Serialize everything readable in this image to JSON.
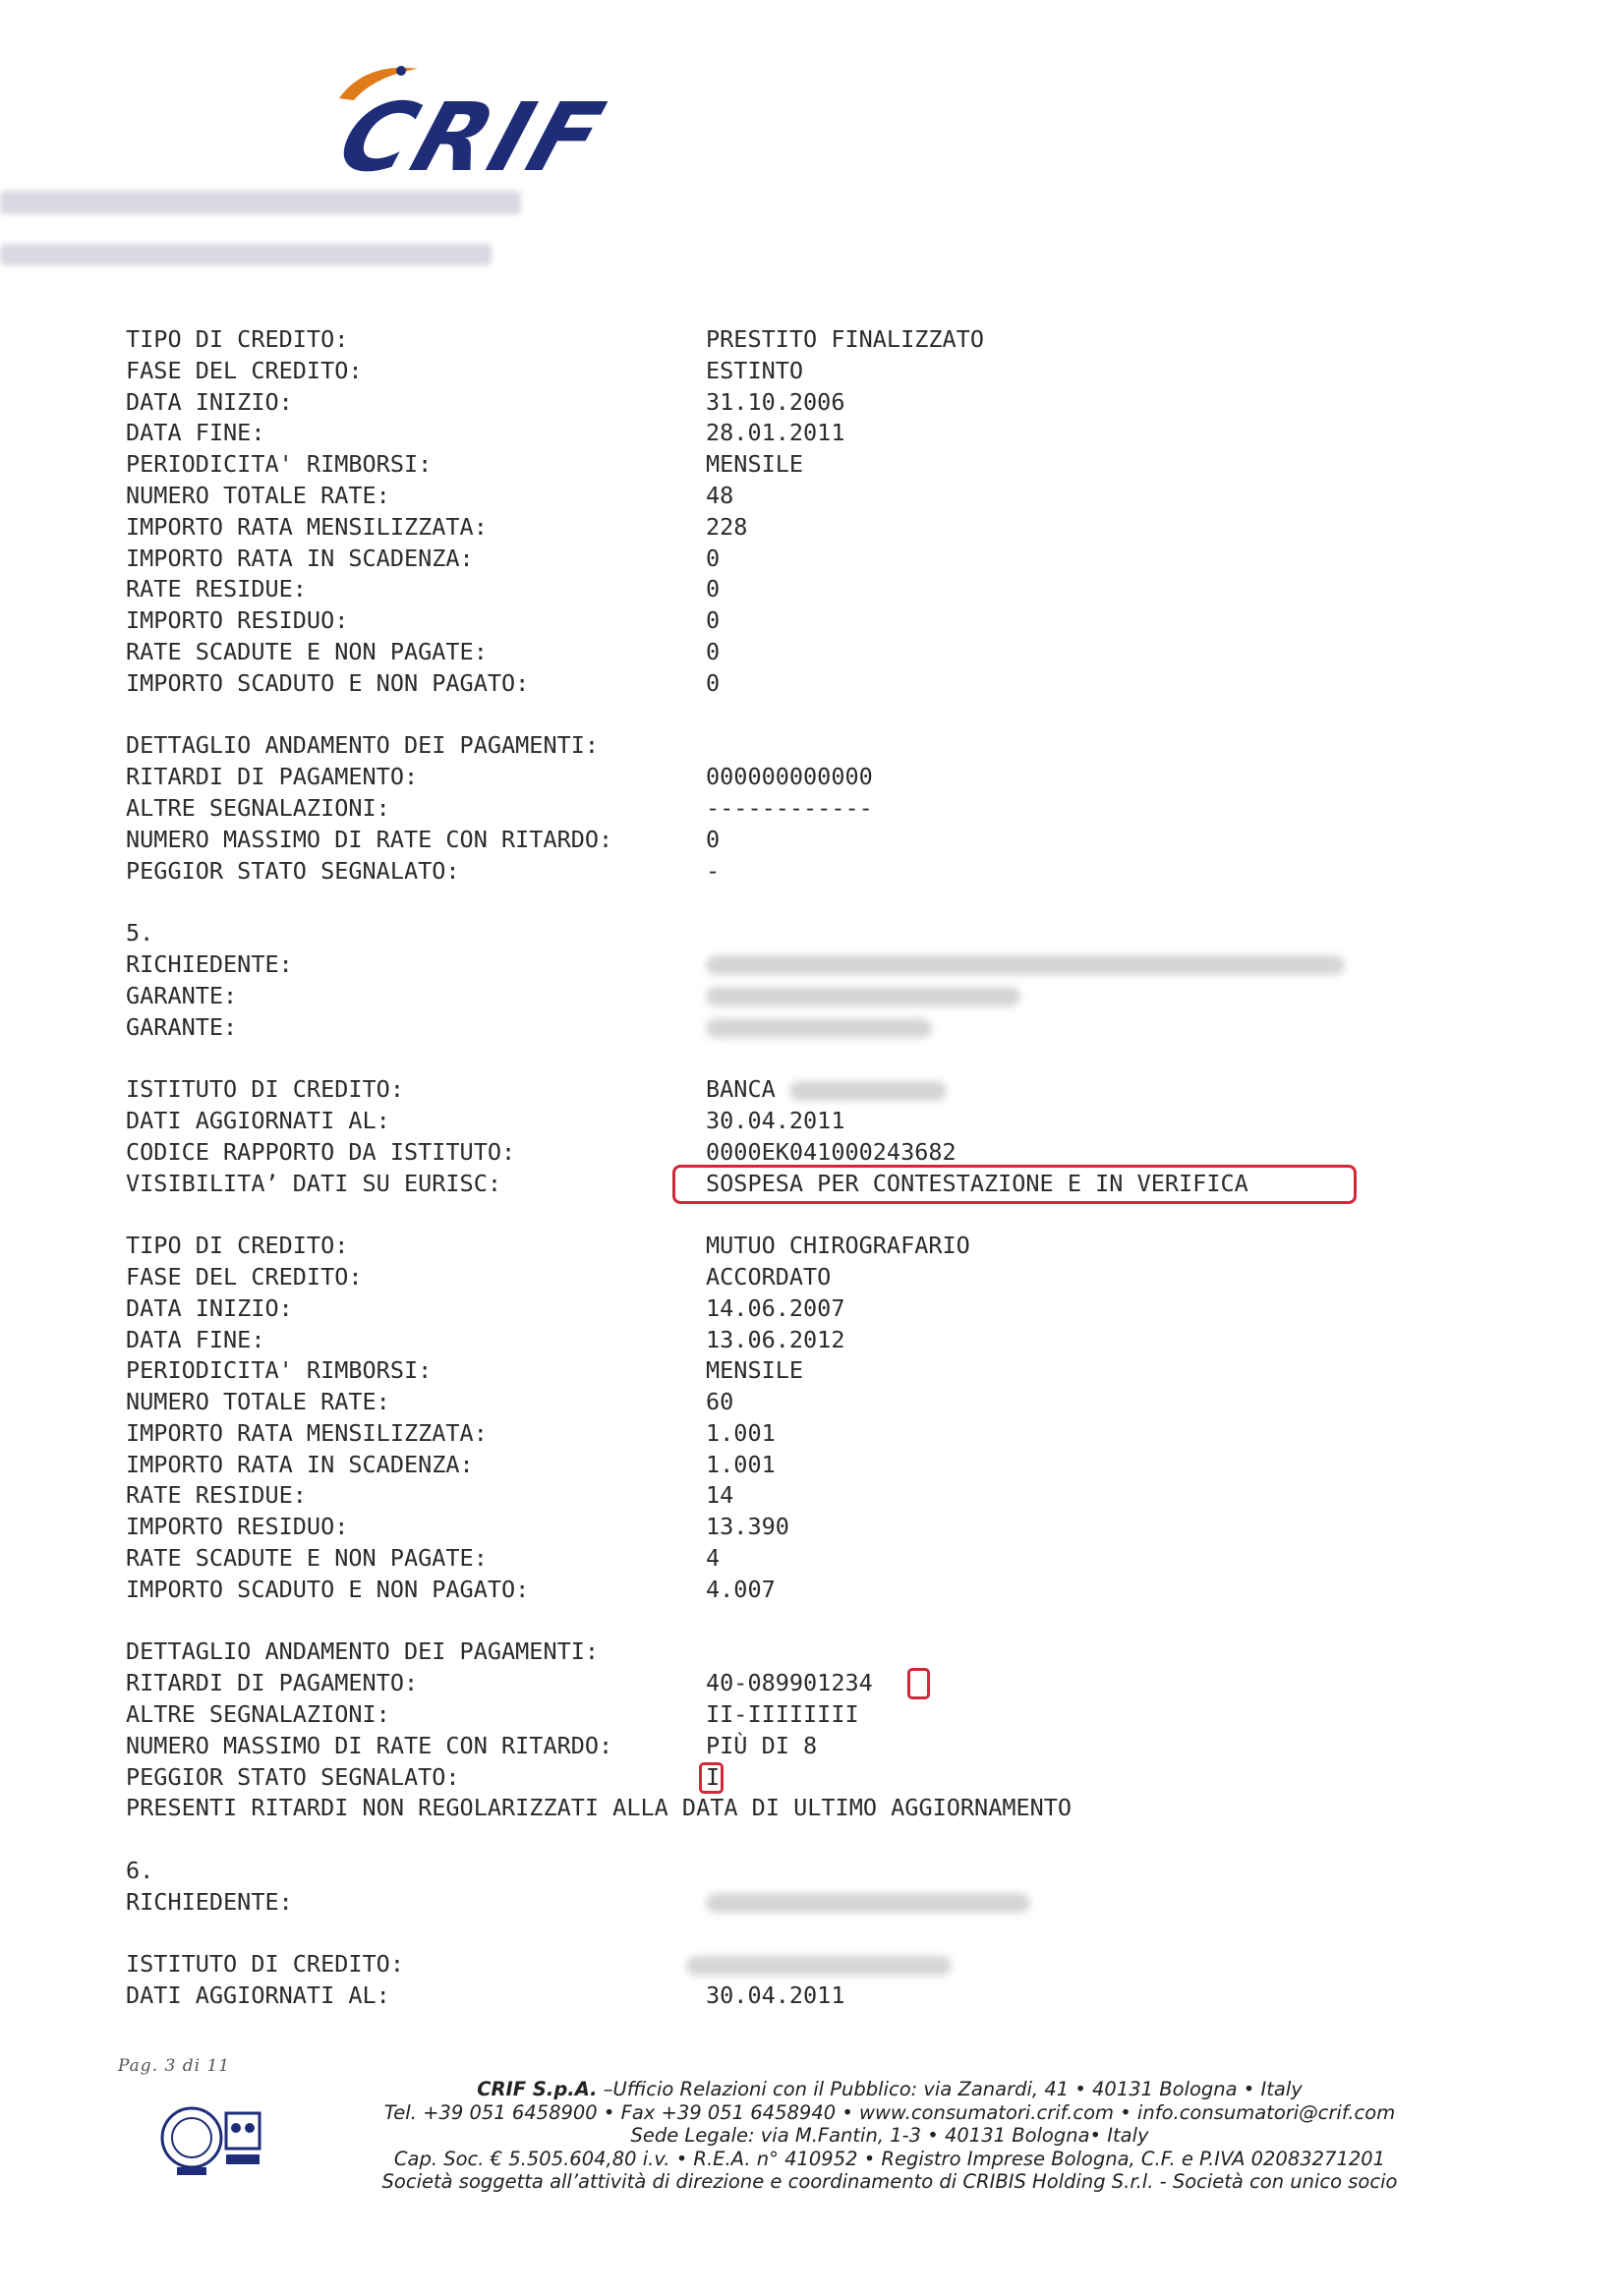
{
  "header": {
    "logo_text": "CRIF"
  },
  "block_a": {
    "rows": [
      {
        "label": "TIPO DI CREDITO:",
        "value": "PRESTITO FINALIZZATO"
      },
      {
        "label": "FASE DEL CREDITO:",
        "value": "ESTINTO"
      },
      {
        "label": "DATA INIZIO:",
        "value": "31.10.2006"
      },
      {
        "label": "DATA FINE:",
        "value": "28.01.2011"
      },
      {
        "label": "PERIODICITA' RIMBORSI:",
        "value": "MENSILE"
      },
      {
        "label": "NUMERO TOTALE RATE:",
        "value": "48"
      },
      {
        "label": "IMPORTO RATA MENSILIZZATA:",
        "value": "228"
      },
      {
        "label": "IMPORTO RATA IN SCADENZA:",
        "value": "0"
      },
      {
        "label": "RATE RESIDUE:",
        "value": "0"
      },
      {
        "label": "IMPORTO RESIDUO:",
        "value": "0"
      },
      {
        "label": "RATE SCADUTE E NON PAGATE:",
        "value": "0"
      },
      {
        "label": "IMPORTO SCADUTO E NON PAGATO:",
        "value": "0"
      }
    ],
    "payments_title": "DETTAGLIO ANDAMENTO DEI PAGAMENTI:",
    "payments": [
      {
        "label": "RITARDI DI PAGAMENTO:",
        "value": "000000000000"
      },
      {
        "label": "ALTRE SEGNALAZIONI:",
        "value": "------------"
      },
      {
        "label": "NUMERO MASSIMO DI RATE CON RITARDO:",
        "value": "0"
      },
      {
        "label": "PEGGIOR STATO SEGNALATO:",
        "value": "-"
      }
    ]
  },
  "section5": {
    "number": "5.",
    "parties": [
      {
        "label": "RICHIEDENTE:"
      },
      {
        "label": "GARANTE:"
      },
      {
        "label": "GARANTE:"
      }
    ],
    "institute": [
      {
        "label": "ISTITUTO DI CREDITO:",
        "value": "BANCA"
      },
      {
        "label": "DATI AGGIORNATI AL:",
        "value": "30.04.2011"
      },
      {
        "label": "CODICE RAPPORTO DA ISTITUTO:",
        "value": "0000EK041000243682"
      },
      {
        "label": "VISIBILITA’ DATI SU EURISC:",
        "value": "SOSPESA PER CONTESTAZIONE E IN VERIFICA"
      }
    ],
    "rows": [
      {
        "label": "TIPO DI CREDITO:",
        "value": "MUTUO CHIROGRAFARIO"
      },
      {
        "label": "FASE DEL CREDITO:",
        "value": "ACCORDATO"
      },
      {
        "label": "DATA INIZIO:",
        "value": "14.06.2007"
      },
      {
        "label": "DATA FINE:",
        "value": "13.06.2012"
      },
      {
        "label": "PERIODICITA' RIMBORSI:",
        "value": "MENSILE"
      },
      {
        "label": "NUMERO TOTALE RATE:",
        "value": "60"
      },
      {
        "label": "IMPORTO RATA MENSILIZZATA:",
        "value": "1.001"
      },
      {
        "label": "IMPORTO RATA IN SCADENZA:",
        "value": "1.001"
      },
      {
        "label": "RATE RESIDUE:",
        "value": "14"
      },
      {
        "label": "IMPORTO RESIDUO:",
        "value": "13.390"
      },
      {
        "label": "RATE SCADUTE E NON PAGATE:",
        "value": "4"
      },
      {
        "label": "IMPORTO SCADUTO E NON PAGATO:",
        "value": "4.007"
      }
    ],
    "payments_title": "DETTAGLIO ANDAMENTO DEI PAGAMENTI:",
    "payments": [
      {
        "label": "RITARDI DI PAGAMENTO:",
        "value": "40-08990123",
        "value_highlight": "4"
      },
      {
        "label": "ALTRE SEGNALAZIONI:",
        "value": "II-IIIIIIII"
      },
      {
        "label": "NUMERO MASSIMO DI RATE CON RITARDO:",
        "value": "PIÙ DI 8"
      },
      {
        "label": "PEGGIOR STATO SEGNALATO:",
        "value": "I"
      }
    ],
    "note": "PRESENTI RITARDI NON REGOLARIZZATI ALLA DATA DI ULTIMO AGGIORNAMENTO"
  },
  "section6": {
    "number": "6.",
    "applicant_label": "RICHIEDENTE:",
    "institute_label": "ISTITUTO DI CREDITO:",
    "updated_label": "DATI AGGIORNATI AL:",
    "updated_value": "30.04.2011"
  },
  "footer": {
    "page_label": "Pag. 3 di 11",
    "company": "CRIF S.p.A.",
    "line1": " –Ufficio Relazioni con il Pubblico: via Zanardi, 41 • 40131 Bologna • Italy",
    "line2": "Tel. +39 051 6458900 • Fax +39 051 6458940 • www.consumatori.crif.com • info.consumatori@crif.com",
    "line3": "Sede Legale: via M.Fantin, 1-3 • 40131 Bologna• Italy",
    "line4": "Cap. Soc. € 5.505.604,80 i.v. • R.E.A. n° 410952 • Registro Imprese Bologna, C.F. e P.IVA 02083271201",
    "line5": "Società soggetta all’attività di direzione e coordinamento di CRIBIS Holding S.r.l. - Società con unico socio"
  },
  "colors": {
    "logo_blue": "#1f2d78",
    "logo_orange": "#e07b1a",
    "highlight_red": "#d0283a"
  }
}
